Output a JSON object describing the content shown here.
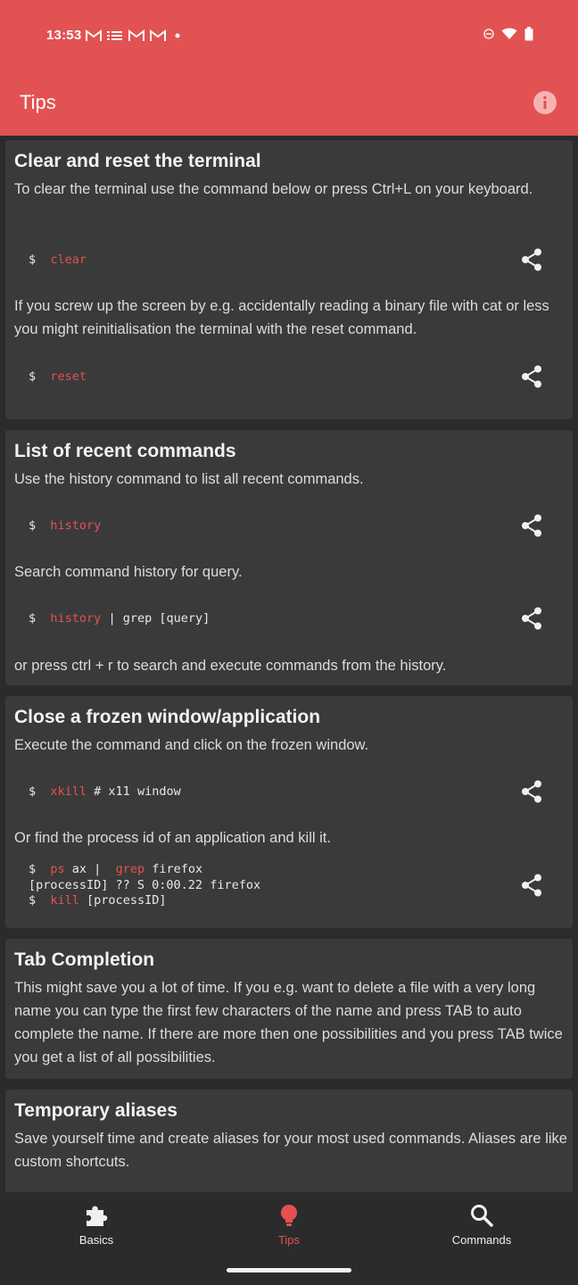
{
  "status_bar": {
    "time": "13:53"
  },
  "app_bar": {
    "title": "Tips",
    "info_icon": "info-icon"
  },
  "cards": [
    {
      "title": "Clear and reset the terminal",
      "p1": "To clear the terminal use the command below or press Ctrl+L on your keyboard.",
      "cmd1": {
        "prompt": "$",
        "keyword": "clear",
        "rest": ""
      },
      "p2": "If you screw up the screen by e.g. accidentally reading a binary file with cat or less you might reinitialisation the terminal with the reset command.",
      "cmd2": {
        "prompt": "$",
        "keyword": "reset",
        "rest": ""
      }
    },
    {
      "title": "List of recent commands",
      "p1": "Use the history command to list all recent commands.",
      "cmd1": {
        "prompt": "$",
        "keyword": "history",
        "rest": ""
      },
      "p2": "Search command history for query.",
      "cmd2": {
        "prompt": "$",
        "keyword": "history",
        "rest": " | grep [query]"
      },
      "p3": "or press ctrl + r to search and execute commands from the history."
    },
    {
      "title": "Close a frozen window/application",
      "p1": "Execute the command and click on the frozen window.",
      "cmd1": {
        "prompt": "$",
        "keyword": "xkill",
        "rest": " # x11 window"
      },
      "p2": "Or find the process id of an application and kill it.",
      "cmd2": {
        "line1": {
          "prompt": "$",
          "kw1": "ps",
          "mid": " ax |  ",
          "kw2": "grep",
          "rest": " firefox"
        },
        "line2": "[processID] ?? S 0:00.22 firefox",
        "line3": {
          "prompt": "$",
          "kw": "kill",
          "rest": " [processID]"
        }
      }
    },
    {
      "title": "Tab Completion",
      "p1": "This might save you a lot of time. If you e.g. want to delete a file with a very long name you can type the first few characters of the name and press TAB to auto complete the name. If there are more then one possibilities and you press TAB twice you get a list of all possibilities."
    },
    {
      "title": "Temporary aliases",
      "p1": "Save yourself time and create aliases for your most used commands. Aliases are like custom shortcuts."
    }
  ],
  "bottom_nav": {
    "items": [
      {
        "label": "Basics",
        "icon": "puzzle-icon"
      },
      {
        "label": "Tips",
        "icon": "lightbulb-icon",
        "active": true
      },
      {
        "label": "Commands",
        "icon": "search-icon"
      }
    ]
  },
  "colors": {
    "accent": "#e25252",
    "card": "#3a3a3a",
    "background": "#2b2b2b"
  }
}
